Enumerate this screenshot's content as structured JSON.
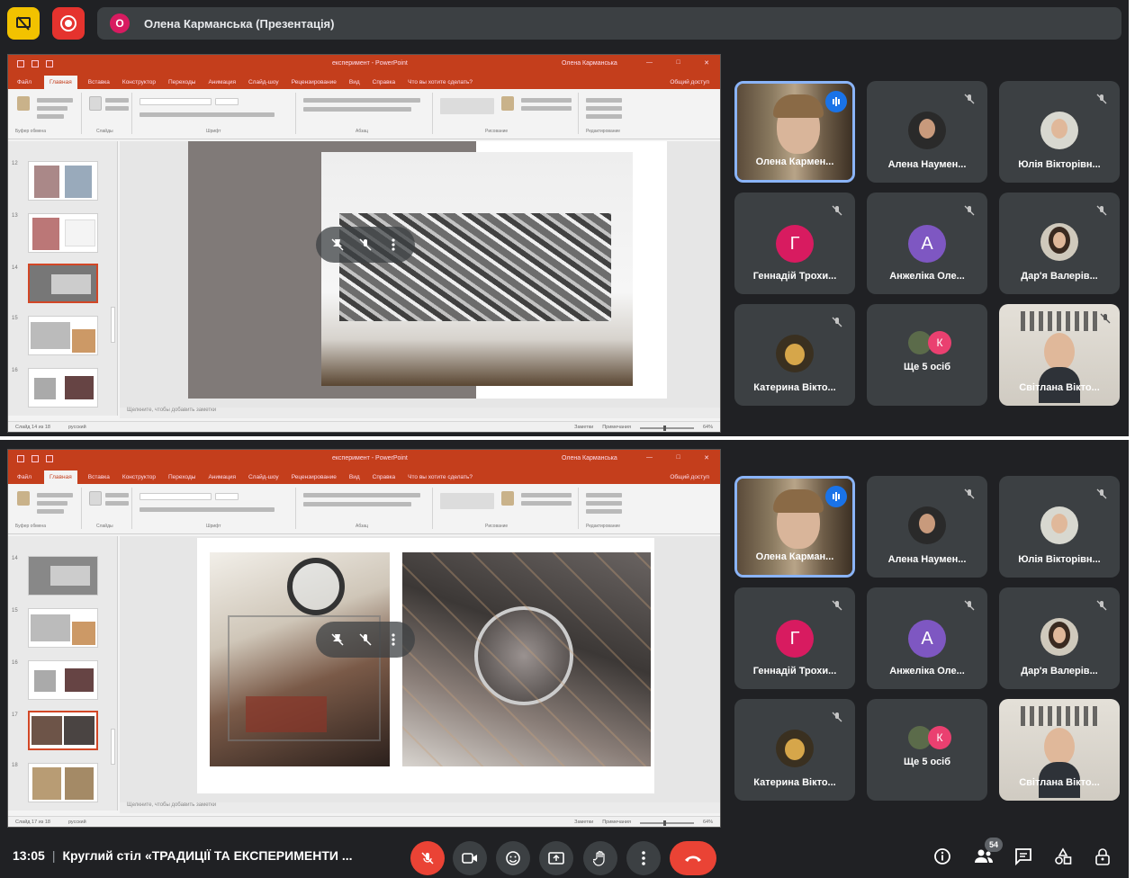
{
  "call": {
    "presenter_initial": "О",
    "presenter_label": "Олена Карманська (Презентація)",
    "time": "13:05",
    "meeting_title": "Круглий стіл «ТРАДИЦІЇ ТА ЕКСПЕРИМЕНТИ ...",
    "participants_count": "54"
  },
  "participants": [
    {
      "name": "Олена Кармен...",
      "type": "video",
      "active": true
    },
    {
      "name": "Алена Наумен...",
      "type": "photo",
      "avatar": "dark-portrait"
    },
    {
      "name": "Юлія Вікторівн...",
      "type": "photo",
      "avatar": "light-portrait"
    },
    {
      "name": "Геннадій Трохи...",
      "type": "letter",
      "letter": "Г",
      "color": "#d81b60"
    },
    {
      "name": "Анжеліка Оле...",
      "type": "letter",
      "letter": "А",
      "color": "#7e57c2"
    },
    {
      "name": "Дар'я Валерів...",
      "type": "photo",
      "avatar": "woman-portrait"
    },
    {
      "name": "Катерина Вікто...",
      "type": "photo",
      "avatar": "gold-portrait"
    },
    {
      "name": "Ще 5 осіб",
      "type": "more",
      "letter": "К",
      "color": "#ea4070"
    },
    {
      "name": "Світлана Вікто...",
      "type": "video"
    }
  ],
  "participants_bottom": [
    {
      "name": "Олена Карман..."
    },
    {
      "name": "Алена Наумен..."
    },
    {
      "name": "Юлія Вікторівн..."
    },
    {
      "name": "Геннадій Трохи..."
    },
    {
      "name": "Анжеліка Оле..."
    },
    {
      "name": "Дар'я Валерів..."
    },
    {
      "name": "Катерина Вікто..."
    },
    {
      "name": "Ще 5 осіб"
    },
    {
      "name": "Світлана Вікто..."
    }
  ],
  "ppt": {
    "title": "експеримент - PowerPoint",
    "user": "Олена Карманська",
    "tabs": [
      "Файл",
      "Главная",
      "Вставка",
      "Конструктор",
      "Переходы",
      "Анимация",
      "Слайд-шоу",
      "Рецензирование",
      "Вид",
      "Справка",
      "Что вы хотите сделать?"
    ],
    "share": "Общий доступ",
    "groups": [
      "Буфер обмена",
      "Слайды",
      "Шрифт",
      "Абзац",
      "Рисование",
      "Редактирование"
    ],
    "notes_placeholder": "Щелкните, чтобы добавить заметки",
    "status_top": "Слайд 14 из 18",
    "status_bottom": "Слайд 17 из 18",
    "status_lang": "русский",
    "status_right": [
      "Заметки",
      "Примечания"
    ],
    "zoom": "64%",
    "thumb_numbers_top": [
      "12",
      "13",
      "14",
      "15",
      "16"
    ],
    "thumb_numbers_bottom": [
      "14",
      "15",
      "16",
      "17",
      "18"
    ]
  },
  "colors": {
    "meet_bg": "#202124",
    "tile_bg": "#3c4043",
    "ppt_red": "#c43e1c",
    "end_call": "#ea4335",
    "active_border": "#8ab4f8"
  }
}
